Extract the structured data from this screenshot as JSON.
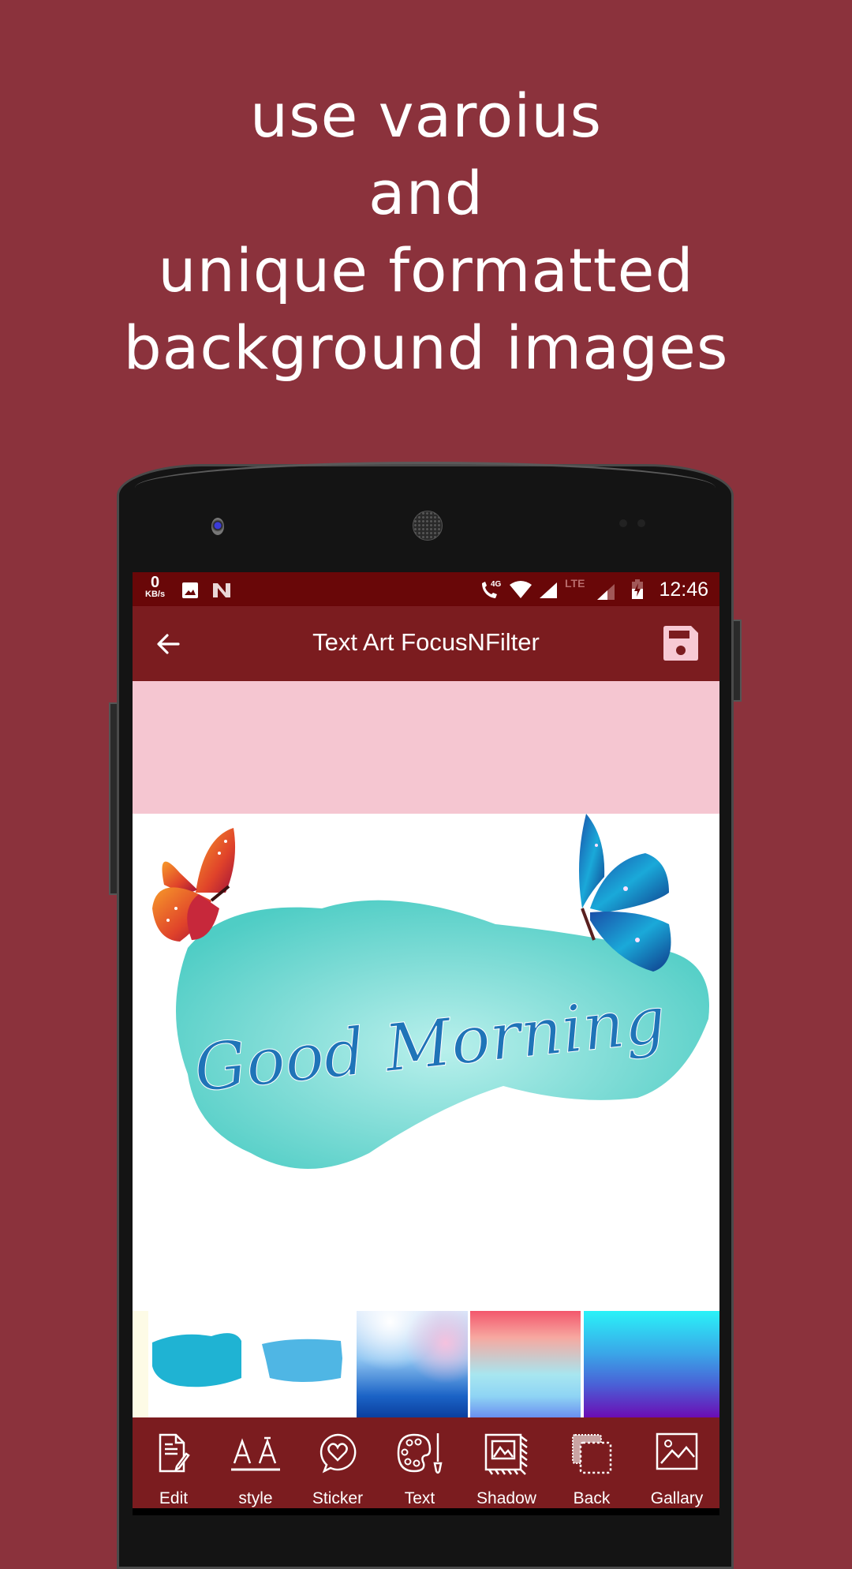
{
  "headline": {
    "lines": [
      "use varoius",
      "and",
      "unique formatted",
      "background images"
    ]
  },
  "status_bar": {
    "network_speed_value": "0",
    "network_speed_unit": "KB/s",
    "icons": [
      "gallery-notification-icon",
      "n-app-icon",
      "volte-4g-call-icon",
      "wifi-icon",
      "signal-icon",
      "lte-signal-icon",
      "battery-charging-icon"
    ],
    "volte_label": "4G",
    "lte_label": "LTE",
    "time": "12:46"
  },
  "app_bar": {
    "title": "Text Art FocusNFilter",
    "back_icon": "arrow-left-icon",
    "save_icon": "floppy-disk-icon"
  },
  "canvas": {
    "text": "Good Morning",
    "stickers": [
      "orange-butterfly",
      "blue-butterfly"
    ],
    "background": "teal-watercolor-splash"
  },
  "background_thumbnails": [
    {
      "name": "teal-brush-stroke-1"
    },
    {
      "name": "blue-brush-stroke-2"
    },
    {
      "name": "blue-pink-gradient"
    },
    {
      "name": "red-cyan-gradient"
    },
    {
      "name": "cyan-purple-gradient"
    }
  ],
  "toolbar": {
    "items": [
      {
        "label": "Edit",
        "icon": "edit-document-icon"
      },
      {
        "label": "style",
        "icon": "font-style-icon"
      },
      {
        "label": "Sticker",
        "icon": "heart-sticker-icon"
      },
      {
        "label": "Text",
        "icon": "palette-brush-icon"
      },
      {
        "label": "Shadow",
        "icon": "image-shadow-icon"
      },
      {
        "label": "Back",
        "icon": "layers-background-icon"
      },
      {
        "label": "Gallary",
        "icon": "gallery-image-icon"
      }
    ]
  },
  "colors": {
    "page_background": "#8b323c",
    "status_bar": "#690708",
    "app_bar": "#7b1c1f",
    "pink_band": "#f5c6d1",
    "text_accent": "#1f74b8"
  }
}
